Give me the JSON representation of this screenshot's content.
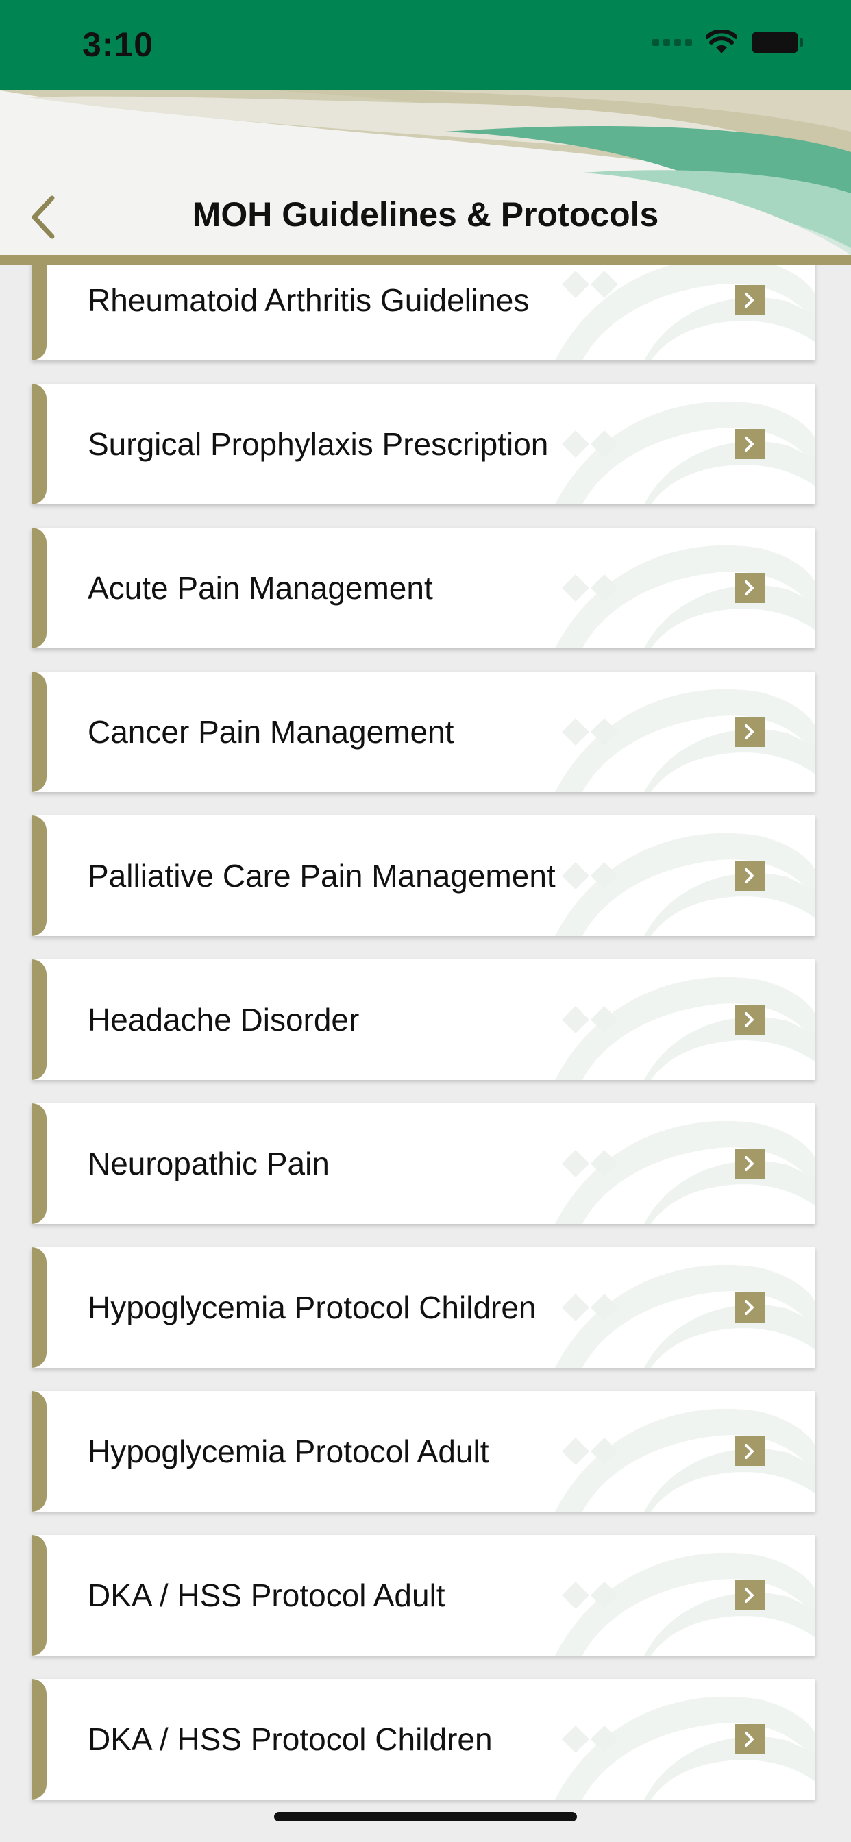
{
  "status_bar": {
    "time": "3:10",
    "icons": [
      "cellular-signal-icon",
      "wifi-icon",
      "battery-icon"
    ]
  },
  "header": {
    "title": "MOH Guidelines & Protocols",
    "back_icon": "chevron-left-icon"
  },
  "colors": {
    "status_bar_green": "#008552",
    "accent_gold": "#a39a68",
    "background": "#ededed",
    "card": "#ffffff"
  },
  "list": {
    "items": [
      {
        "label": "Rheumatoid Arthritis Guidelines"
      },
      {
        "label": "Surgical Prophylaxis Prescription"
      },
      {
        "label": "Acute Pain Management"
      },
      {
        "label": "Cancer Pain Management"
      },
      {
        "label": "Palliative Care Pain Management"
      },
      {
        "label": "Headache Disorder"
      },
      {
        "label": "Neuropathic Pain"
      },
      {
        "label": "Hypoglycemia Protocol Children"
      },
      {
        "label": "Hypoglycemia Protocol Adult"
      },
      {
        "label": "DKA / HSS Protocol Adult"
      },
      {
        "label": "DKA / HSS Protocol Children"
      }
    ]
  }
}
